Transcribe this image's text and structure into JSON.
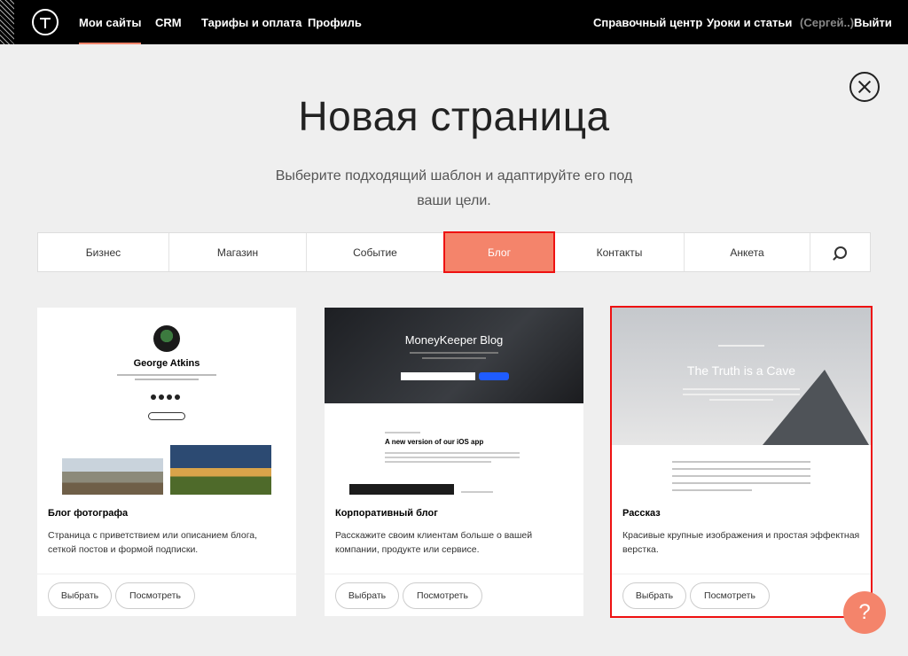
{
  "nav": {
    "left": [
      "Мои сайты",
      "CRM",
      "Тарифы и оплата",
      "Профиль"
    ],
    "right": {
      "help": "Справочный центр",
      "lessons": "Уроки и статьи",
      "user": "(Сергей..)",
      "logout": "Выйти"
    }
  },
  "header": {
    "title": "Новая страница",
    "subtitle": "Выберите подходящий шаблон и адаптируйте его под ваши цели."
  },
  "tabs": [
    "Бизнес",
    "Магазин",
    "Событие",
    "Блог",
    "Контакты",
    "Анкета"
  ],
  "active_tab": "Блог",
  "cards": [
    {
      "title": "Блог фотографа",
      "description": "Страница с приветствием или описанием блога, сеткой постов и формой подписки.",
      "preview_name": "George Atkins",
      "select": "Выбрать",
      "view": "Посмотреть"
    },
    {
      "title": "Корпоративный блог",
      "description": "Расскажите своим клиентам больше о вашей компании, продукте или сервисе.",
      "preview_title": "MoneyKeeper Blog",
      "preview_heading": "A new version of our iOS app",
      "select": "Выбрать",
      "view": "Посмотреть"
    },
    {
      "title": "Рассказ",
      "description": "Красивые крупные изображения и простая эффектная верстка.",
      "preview_title": "The Truth is a Cave",
      "select": "Выбрать",
      "view": "Посмотреть"
    }
  ],
  "help_bubble": "?",
  "colors": {
    "accent": "#f4846b",
    "selection": "#ee1111",
    "nav_bg": "#000000"
  }
}
